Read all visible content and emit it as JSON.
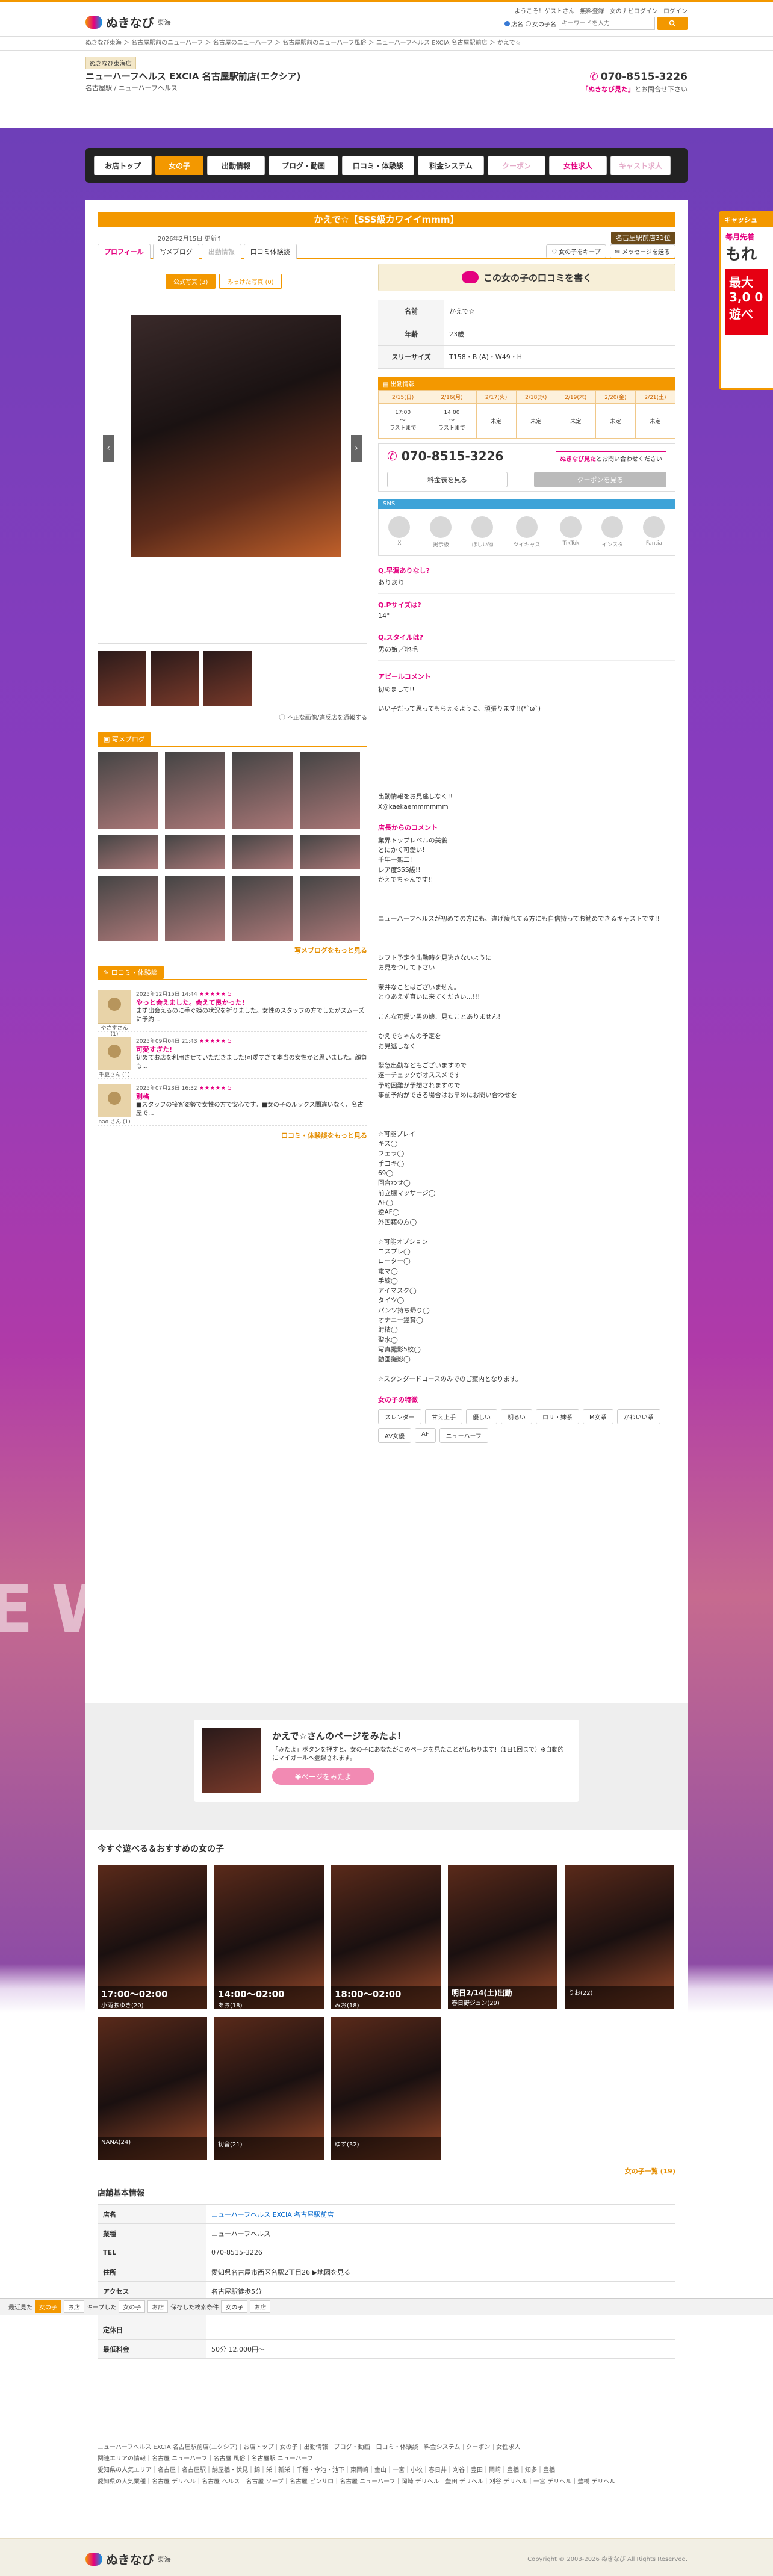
{
  "header": {
    "top_links": [
      "ようこそ！ゲストさん",
      "無料登録",
      "女のナビログイン",
      "ログイン"
    ],
    "breadcrumb_top": "かえで☆「ニューハーフヘルス EXCIA 名古屋駅前店・名古屋 | ニューハーフヘルス",
    "logo_text": "ぬきなび",
    "logo_area": "東海",
    "search": {
      "radio_shop": "店名",
      "radio_girl": "女の子名",
      "placeholder": "キーワードを入力"
    }
  },
  "breadcrumb": [
    "ぬきなび東海",
    "名古屋駅前のニューハーフ",
    "名古屋のニューハーフ",
    "名古屋駅前のニューハーフ風俗",
    "ニューハーフヘルス EXCIA 名古屋駅前店",
    "かえで☆"
  ],
  "shop": {
    "badge": "ぬきなび東海店",
    "name": "ニューハーフヘルス EXCIA 名古屋駅前店(エクシア)",
    "sub": "名古屋駅 / ニューハーフヘルス",
    "tel": "070-8515-3226",
    "tel_sub_em": "「ぬきなび見た」",
    "tel_sub": "とお問合せ下さい"
  },
  "nav": [
    "お店トップ",
    "女の子",
    "出勤情報",
    "ブログ・動画",
    "口コミ・体験談",
    "料金システム",
    "クーポン",
    "女性求人",
    "キャスト求人"
  ],
  "girl": {
    "title": "かえで☆【SSS級カワイイmmm】",
    "updated": "2026年2月15日 更新↑",
    "rank": "名古屋駅前店31位",
    "tabs": [
      "プロフィール",
      "写メブログ",
      "出勤情報",
      "口コミ体験談"
    ],
    "keep": "女の子をキープ",
    "message": "メッセージを送る",
    "photo_tabs": [
      "公式写真 (3)",
      "みっけた写真 (0)"
    ],
    "photo_note": "不正な画像/違反店を通報する",
    "review_btn": "この女の子の口コミを書く",
    "profile": [
      {
        "k": "名前",
        "v": "かえで☆"
      },
      {
        "k": "年齢",
        "v": "23歳"
      },
      {
        "k": "スリーサイズ",
        "v": "T158・B (A)・W49・H"
      }
    ],
    "schedule_head": "出勤情報",
    "schedule_days": [
      "2/15(日)",
      "2/16(月)",
      "2/17(火)",
      "2/18(水)",
      "2/19(木)",
      "2/20(金)",
      "2/21(土)"
    ],
    "schedule_vals": [
      "17:00\n〜\nラストまで",
      "14:00\n〜\nラストまで",
      "未定",
      "未定",
      "未定",
      "未定",
      "未定"
    ],
    "call_tel": "070-8515-3226",
    "call_em": "ぬきなび見た",
    "call_msg": "とお問い合わせください",
    "price_btn": "料金表を見る",
    "coupon_btn": "クーポンを見る",
    "sns_head": "SNS",
    "sns": [
      "X",
      "掲示板",
      "ほしい物",
      "ツイキャス",
      "TikTok",
      "インスタ",
      "Fantia"
    ],
    "qa": [
      {
        "q": "Q.早漏ありなし?",
        "a": "ありあり"
      },
      {
        "q": "Q.Pサイズは?",
        "a": "14°"
      },
      {
        "q": "Q.スタイルは?",
        "a": "男の娘／地毛"
      }
    ],
    "appeal_head": "アピールコメント",
    "appeal": "初めまして!!\n\nいい子だって思ってもらえるように、頑張ります!!(*`ω`)\n\n\n\n\n\n\n\n\n出勤情報をお見逃しなく!!\nX@kaekaemmmmmm",
    "shop_head": "店長からのコメント",
    "shop_comment": "業界トップレベルの美貌\nとにかく可愛い!\n千年一無二!\nレア度SSS級!!\nかえでちゃんです!!\n\n\n\nニューハーフヘルスが初めての方にも、違げ痩れてる方にも自信持ってお勧めできるキャストです!!\n\n\n\nシフト予定や出勤時を見逃さないように\nお見をつけて下さい\n\n奈井なことはございません。\nとりあえず直いに来てください...!!!\n\nこんな可愛い男の娘、見たことありません!\n\nかえでちゃんの予定を\nお見逃しなく\n\n緊急出勤などもございますので\n逐一チェックがオススメです\n予約困難が予想されますので\n事前予約ができる場合はお早めにお問い合わせを\n\n\n\n☆可能プレイ\nキス◯\nフェラ◯\n手コキ◯\n69◯\n回合わせ◯\n前立腺マッサージ◯\nAF◯\n逆AF◯\n外国籍の方◯\n\n☆可能オプション\nコスプレ◯\nローター◯\n電マ◯\n手錠◯\nアイマスク◯\nタイツ◯\nパンツ持ち帰り◯\nオナニー鑑賞◯\n射精◯\n聖水◯\n写真撮影5枚◯\n動画撮影◯\n\n☆スタンダードコースのみでのご案内となります。",
    "features_head": "女の子の特徴",
    "features": [
      "スレンダー",
      "甘え上手",
      "優しい",
      "明るい",
      "ロリ・妹系",
      "M女系",
      "かわいい系",
      "AV女優",
      "AF",
      "ニューハーフ"
    ],
    "blog_head": "写メブログ",
    "blog_more": "写メブログをもっと見る",
    "review_head": "口コミ・体験談",
    "reviews": [
      {
        "date": "2025年12月15日 14:44",
        "stars": "★★★★★ 5",
        "title": "やっと会えました。会えて良かった!",
        "body": "まず出会えるのに手ぐ姫の状況を祈りました。女性のスタッフの方でしたがスムーズに予約...",
        "name": "やさすさん (1)"
      },
      {
        "date": "2025年09月04日 21:43",
        "stars": "★★★★★ 5",
        "title": "可愛すぎた!",
        "body": "初めてお店を利用させていただきました!可愛すぎて本当の女性かと思いました。顔負も...",
        "name": "千夏さん (1)"
      },
      {
        "date": "2025年07月23日 16:32",
        "stars": "★★★★★ 5",
        "title": "別格",
        "body": "■スタッフの接客姿勢で女性の方で安心です。■女の子のルックス間違いなく、名古屋で...",
        "name": "bao さん (1)"
      }
    ],
    "review_more": "口コミ・体験談をもっと見る"
  },
  "promo": {
    "title": "かえで☆さんのページをみたよ!",
    "text": "「みたよ」ボタンを押すと、女の子にあなたがこのページを見たことが伝わります!（1日1回まで）※自動的にマイガールへ登録されます。",
    "button": "ページをみたよ"
  },
  "recommend": {
    "head": "今すぐ遊べる＆おすすめの女の子",
    "items": [
      {
        "time": "17:00〜02:00",
        "name": "小雨おゆき(20)"
      },
      {
        "time": "14:00〜02:00",
        "name": "あお(18)"
      },
      {
        "time": "18:00〜02:00",
        "name": "みお(18)"
      },
      {
        "time": "明日2/14(土)出勤",
        "name": "春日野ジュン(29)"
      },
      {
        "time": "",
        "name": "りお(22)"
      },
      {
        "time": "",
        "name": "NANA(24)"
      },
      {
        "time": "",
        "name": "初音(21)"
      },
      {
        "time": "",
        "name": "ゆず(32)"
      }
    ],
    "more": "女の子一覧 (19)"
  },
  "shopinfo": {
    "head": "店舗基本情報",
    "rows": [
      {
        "k": "店名",
        "v": "ニューハーフヘルス EXCIA 名古屋駅前店"
      },
      {
        "k": "業種",
        "v": "ニューハーフヘルス"
      },
      {
        "k": "TEL",
        "v": "070-8515-3226"
      },
      {
        "k": "住所",
        "v": "愛知県名古屋市西区名駅2丁目26 ▶地図を見る"
      },
      {
        "k": "アクセス",
        "v": "名古屋駅徒歩5分"
      },
      {
        "k": "営業時間",
        "v": "12:00〜26:00"
      },
      {
        "k": "定休日",
        "v": ""
      },
      {
        "k": "最低料金",
        "v": "50分 12,000円〜"
      }
    ]
  },
  "bottombar": [
    "最近見た",
    "女の子",
    "お店",
    "キープした",
    "女の子",
    "お店",
    "保存した検索条件",
    "女の子",
    "お店"
  ],
  "footer": {
    "links1": "ニューハーフヘルス EXCIA 名古屋駅前店(エクシア)｜お店トップ｜女の子｜出勤情報｜ブログ・動画｜口コミ・体験談｜料金システム｜クーポン｜女性求人",
    "links2": "関連エリアの情報｜名古屋 ニューハーフ｜名古屋 風俗｜名古屋駅 ニューハーフ",
    "links3": "愛知県の人気エリア｜名古屋｜名古屋駅｜納屋橋・伏見｜錦｜栄｜新栄｜千種・今池・池下｜東岡崎｜金山｜一宮｜小牧｜春日井｜刈谷｜豊田｜岡崎｜豊橋｜知多｜豊橋",
    "links4": "愛知県の人気業種｜名古屋 デリヘル｜名古屋 ヘルス｜名古屋 ソープ｜名古屋 ピンサロ｜名古屋 ニューハーフ｜岡崎 デリヘル｜豊田 デリヘル｜刈谷 デリヘル｜一宮 デリヘル｜豊橋 デリヘル",
    "copyright": "Copyright © 2003-2026 ぬきなび All Rights Reserved."
  },
  "sidead": {
    "head": "キャッシュ",
    "t1": "毎月先着",
    "t2": "もれ",
    "t3": "最大3,0 0 遊べ"
  },
  "bg_text": "EW         LT",
  "colors": {
    "accent": "#f39800",
    "brand_pink": "#e4007f"
  }
}
